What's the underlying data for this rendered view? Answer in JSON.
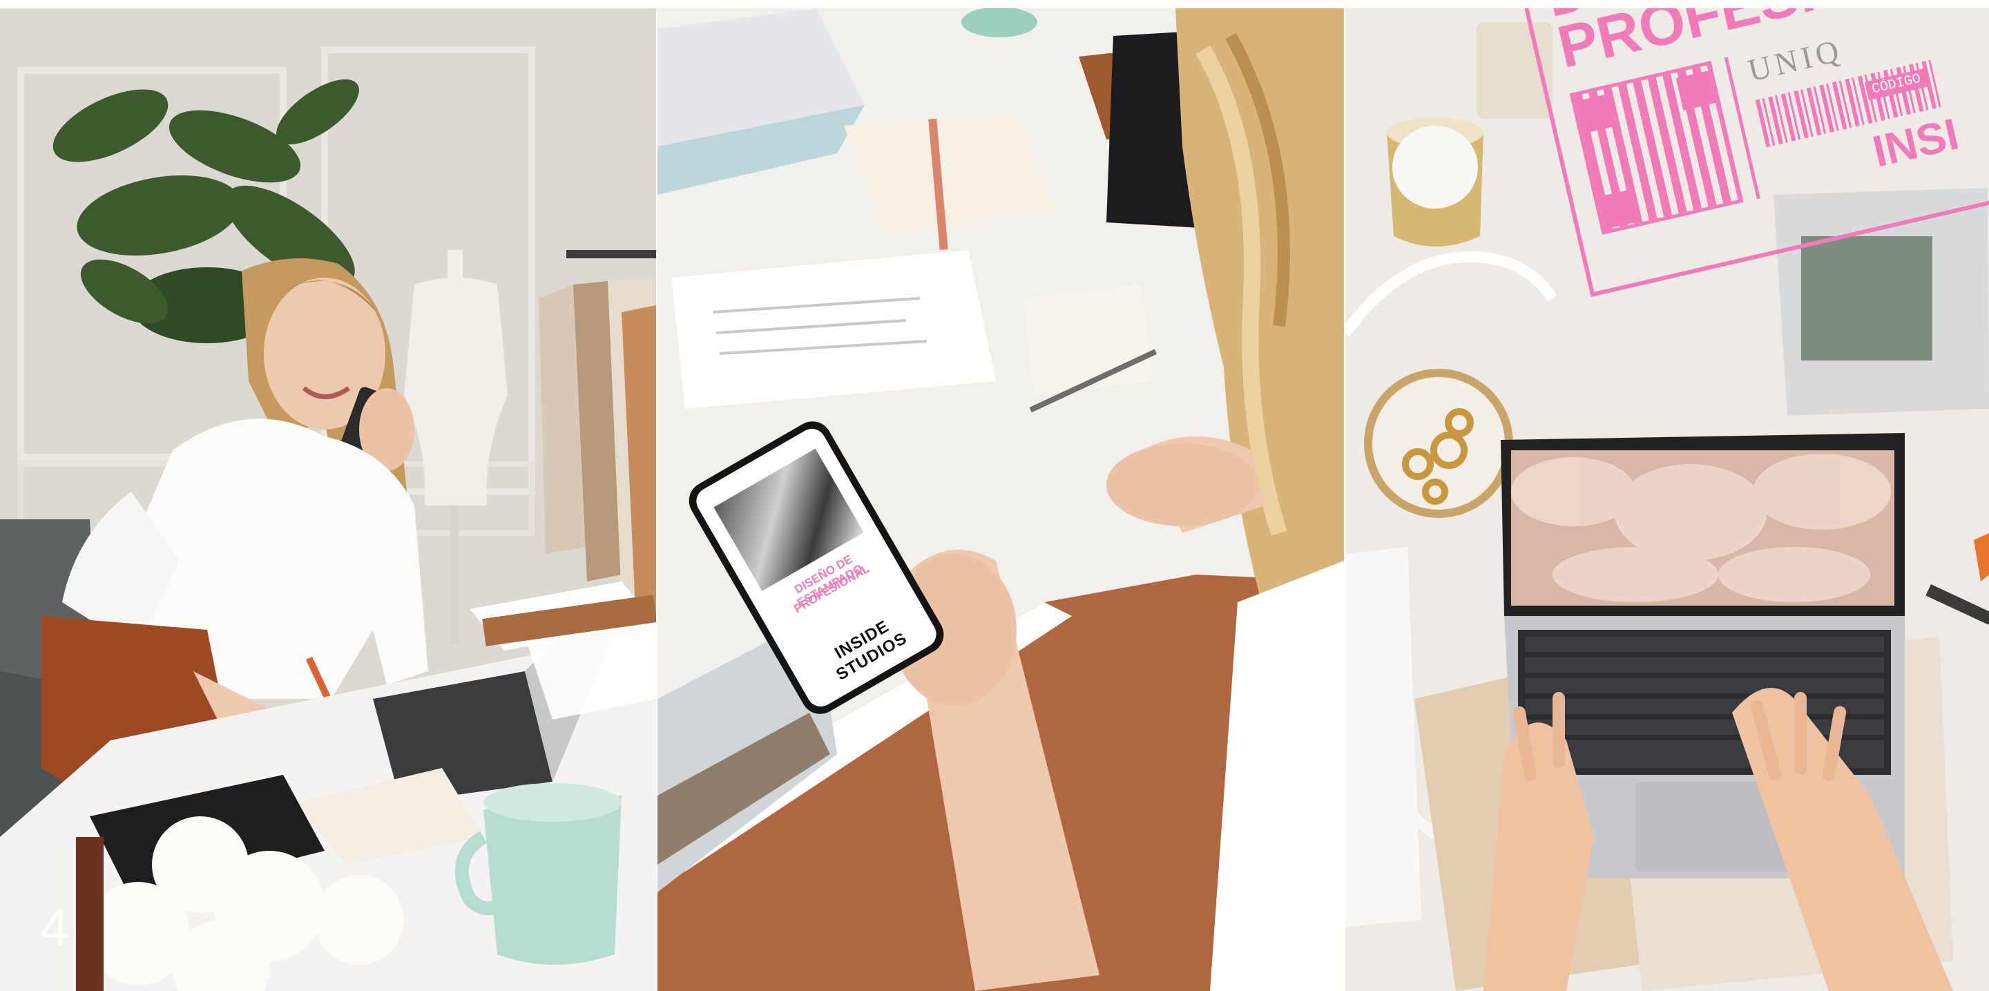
{
  "page": {
    "number": "4"
  },
  "photos": [
    {
      "name": "designer-on-phone-photo"
    },
    {
      "name": "phone-in-hand-photo"
    },
    {
      "name": "laptop-flatlay-photo"
    }
  ],
  "phone_screen": {
    "pink_line_1": "DISEÑO DE ESTAMPADO",
    "pink_line_2": "PROFESIONAL",
    "brand": "INSIDE STUDIOS"
  },
  "stamp": {
    "line_1": "DISEÑO",
    "line_2": "PROFESIONAL",
    "code_label": "CÓDIGO",
    "brand_partial": "INSI",
    "card_partial": "UNIQ"
  },
  "colors": {
    "accent_pink": "#f07bb8",
    "mint": "#b7dcd2"
  }
}
